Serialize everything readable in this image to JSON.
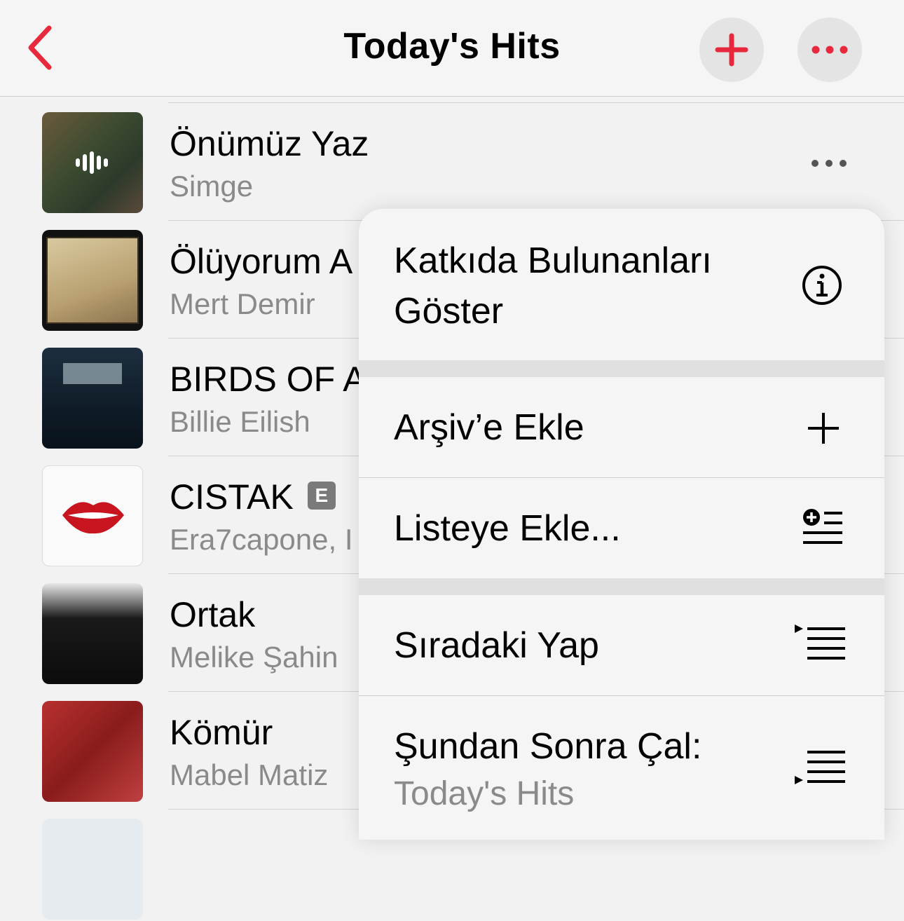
{
  "header": {
    "title": "Today's Hits",
    "back_icon": "chevron-left-icon",
    "add_icon": "plus-icon",
    "more_icon": "ellipsis-icon",
    "accent_color": "#e8283c"
  },
  "songs": [
    {
      "title": "Önümüz Yaz",
      "artist": "Simge",
      "now_playing": true
    },
    {
      "title": "Ölüyorum A",
      "artist": "Mert Demir"
    },
    {
      "title": "BIRDS OF A",
      "artist": "Billie Eilish"
    },
    {
      "title": "CISTAK",
      "artist": "Era7capone, I",
      "explicit": "E"
    },
    {
      "title": "Ortak",
      "artist": "Melike Şahin"
    },
    {
      "title": "Kömür",
      "artist": "Mabel Matiz"
    }
  ],
  "context_menu": {
    "items": [
      {
        "label_line1": "Katkıda Bulunanları",
        "label_line2": "Göster",
        "icon": "info-circle-icon"
      },
      {
        "label": "Arşiv’e Ekle",
        "icon": "plus-icon"
      },
      {
        "label": "Listeye Ekle...",
        "icon": "add-to-list-icon"
      },
      {
        "label": "Sıradaki Yap",
        "icon": "play-next-icon"
      },
      {
        "label": "Şundan Sonra Çal:",
        "sublabel": "Today's Hits",
        "icon": "play-last-icon"
      }
    ]
  }
}
